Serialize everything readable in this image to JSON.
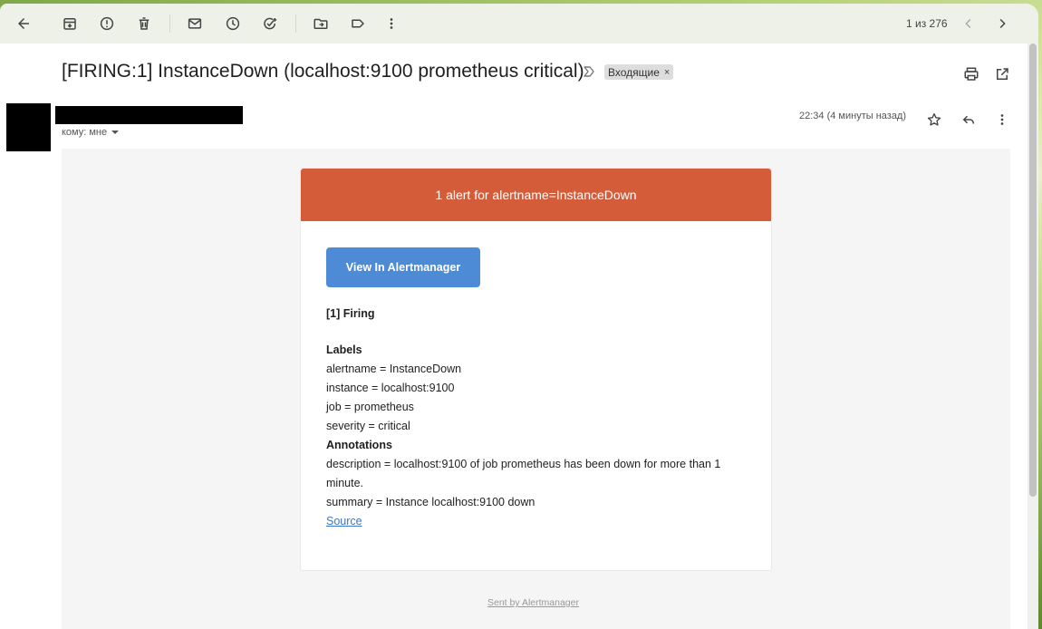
{
  "toolbar": {
    "pager": "1 из 276"
  },
  "message": {
    "subject": "[FIRING:1] InstanceDown (localhost:9100 prometheus critical)",
    "label": "Входящие",
    "label_remove": "×",
    "recipient": "кому: мне",
    "timestamp": "22:34 (4 минуты назад)"
  },
  "email": {
    "header": "1 alert for alertname=InstanceDown",
    "button": "View In Alertmanager",
    "firing": "[1] Firing",
    "labels_title": "Labels",
    "labels": [
      "alertname = InstanceDown",
      "instance = localhost:9100",
      "job = prometheus",
      "severity = critical"
    ],
    "annotations_title": "Annotations",
    "description_line1": "description = localhost:9100 of job prometheus has been down for more than 1",
    "description_line2": "minute.",
    "summary": "summary = Instance localhost:9100 down",
    "source_link": "Source",
    "footer": "Sent by Alertmanager"
  },
  "icons": [
    "back-arrow-icon",
    "archive-icon",
    "report-spam-icon",
    "delete-icon",
    "mark-unread-icon",
    "snooze-icon",
    "add-task-icon",
    "move-to-icon",
    "label-icon",
    "more-vert-icon",
    "chevron-left-icon",
    "chevron-right-icon",
    "importance-marker-icon",
    "print-icon",
    "open-new-window-icon",
    "star-icon",
    "reply-icon",
    "more-vert-icon",
    "dropdown-caret-icon"
  ],
  "colors": {
    "alert_header": "#d45c39",
    "button": "#4e8bd6",
    "link": "#3e76c4"
  }
}
